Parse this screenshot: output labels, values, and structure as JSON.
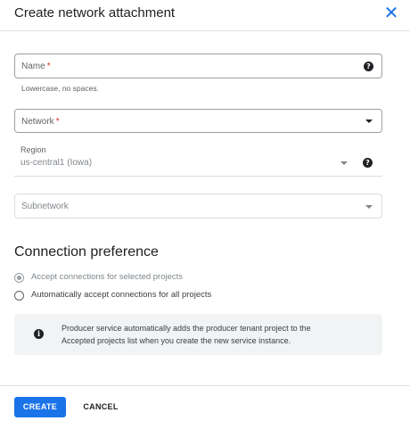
{
  "dialog": {
    "title": "Create network attachment",
    "close_icon": "close-icon"
  },
  "fields": {
    "name": {
      "label": "Name",
      "required_mark": "*",
      "hint": "Lowercase, no spaces.",
      "value": ""
    },
    "network": {
      "label": "Network",
      "required_mark": "*",
      "value": ""
    },
    "region": {
      "label": "Region",
      "value": "us-central1 (Iowa)"
    },
    "subnetwork": {
      "label": "Subnetwork",
      "value": ""
    }
  },
  "connection_preference": {
    "title": "Connection preference",
    "options": [
      {
        "label": "Accept connections for selected projects",
        "selected": true,
        "disabled": true
      },
      {
        "label": "Automatically accept connections for all projects",
        "selected": false,
        "disabled": false
      }
    ]
  },
  "info": {
    "icon": "info-icon",
    "line1": "Producer service automatically adds the producer tenant project to the",
    "line2": "Accepted projects list when you create the new service instance."
  },
  "footer": {
    "create_label": "CREATE",
    "cancel_label": "CANCEL"
  },
  "colors": {
    "accent": "#1a73e8",
    "required": "#d93025",
    "info_background": "#f1f3f4"
  }
}
